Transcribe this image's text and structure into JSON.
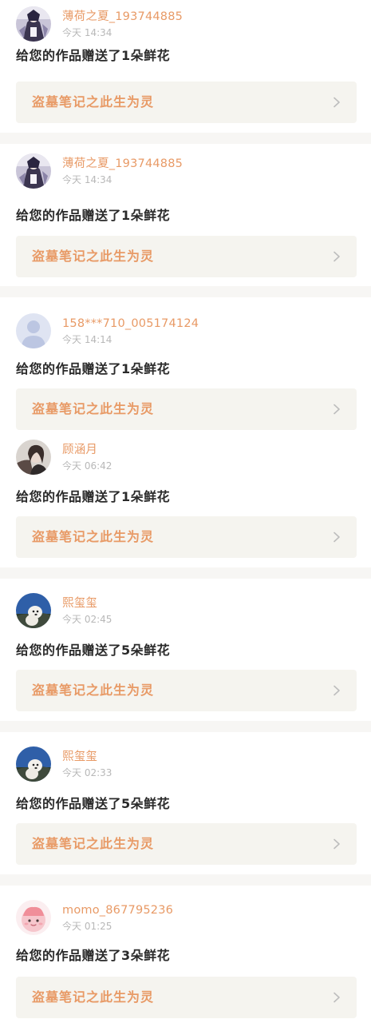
{
  "notifications": [
    {
      "username": "薄荷之夏_193744885",
      "time": "今天 14:34",
      "message": "给您的作品赠送了1朵鲜花",
      "work_title": "盗墓笔记之此生为灵",
      "avatar": "anime-character-avatar"
    },
    {
      "username": "薄荷之夏_193744885",
      "time": "今天 14:34",
      "message": "给您的作品赠送了1朵鲜花",
      "work_title": "盗墓笔记之此生为灵",
      "avatar": "anime-character-avatar"
    },
    {
      "username": "158***710_005174124",
      "time": "今天 14:14",
      "message": "给您的作品赠送了1朵鲜花",
      "work_title": "盗墓笔记之此生为灵",
      "avatar": "default-user-avatar"
    },
    {
      "username": "顾涵月",
      "time": "今天 06:42",
      "message": "给您的作品赠送了1朵鲜花",
      "work_title": "盗墓笔记之此生为灵",
      "avatar": "portrait-photo-avatar"
    },
    {
      "username": "熙玺玺",
      "time": "今天 02:45",
      "message": "给您的作品赠送了5朵鲜花",
      "work_title": "盗墓笔记之此生为灵",
      "avatar": "dog-photo-avatar"
    },
    {
      "username": "熙玺玺",
      "time": "今天 02:33",
      "message": "给您的作品赠送了5朵鲜花",
      "work_title": "盗墓笔记之此生为灵",
      "avatar": "dog-photo-avatar"
    },
    {
      "username": "momo_867795236",
      "time": "今天 01:25",
      "message": "给您的作品赠送了3朵鲜花",
      "work_title": "盗墓笔记之此生为灵",
      "avatar": "cartoon-pink-avatar"
    }
  ],
  "colors": {
    "accent": "#e89a66",
    "text": "#2a2a2a",
    "muted": "#b8b8b8",
    "link_bg": "#f5f4ef",
    "page_bg": "#f7f6f4"
  }
}
